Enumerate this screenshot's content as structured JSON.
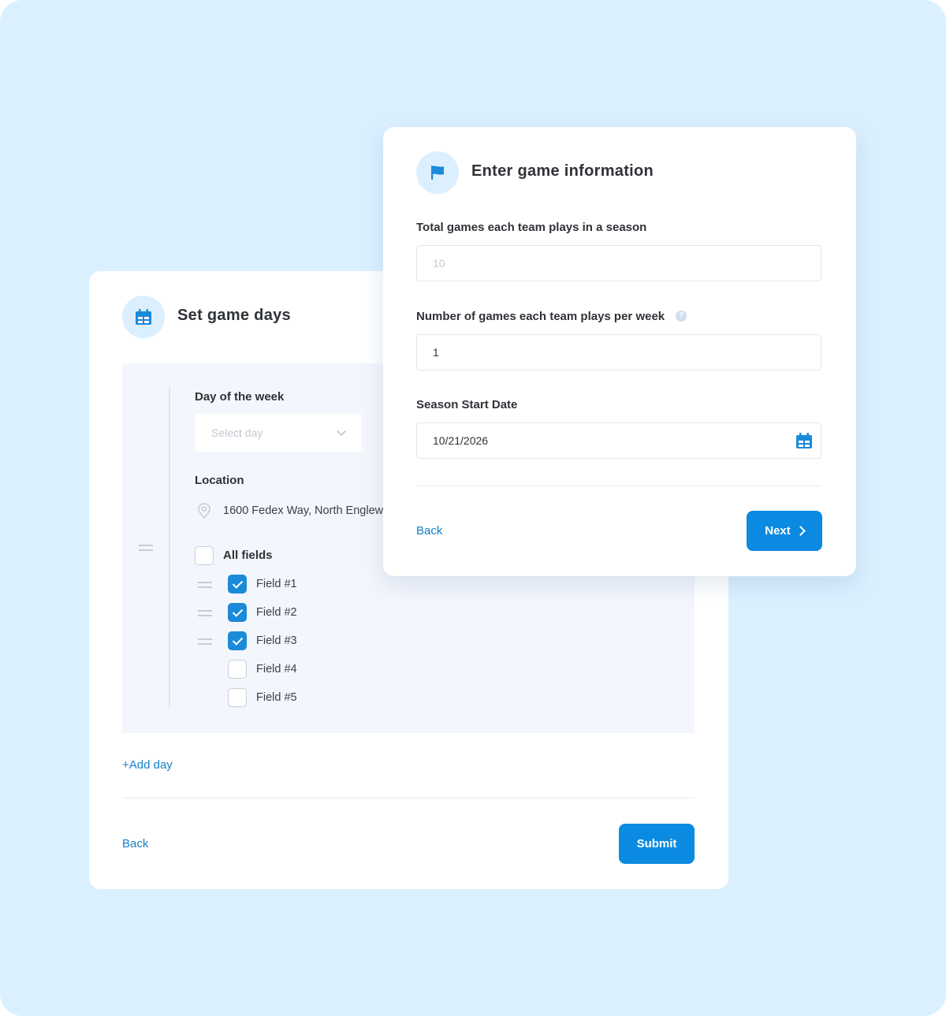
{
  "set_game_days": {
    "title": "Set game days",
    "icon": "calendar-icon",
    "day_of_week_label": "Day of the week",
    "day_select_placeholder": "Select day",
    "location_label": "Location",
    "location_address": "1600 Fedex Way, North Englew",
    "all_fields_label": "All fields",
    "fields": [
      {
        "label": "Field #1",
        "checked": true
      },
      {
        "label": "Field #2",
        "checked": true
      },
      {
        "label": "Field #3",
        "checked": true
      },
      {
        "label": "Field #4",
        "checked": false
      },
      {
        "label": "Field #5",
        "checked": false
      }
    ],
    "add_day_label": "+Add day",
    "back_label": "Back",
    "submit_label": "Submit"
  },
  "enter_game_info": {
    "title": "Enter game information",
    "icon": "flag-icon",
    "total_games_label": "Total games each team plays in a season",
    "total_games_placeholder": "10",
    "games_per_week_label": "Number of games each team plays per week",
    "games_per_week_value": "1",
    "help_icon_glyph": "?",
    "season_start_label": "Season Start Date",
    "season_start_value": "10/21/2026",
    "back_label": "Back",
    "next_label": "Next"
  },
  "colors": {
    "background": "#dbf0ff",
    "accent": "#0a8ae0",
    "link": "#1681cc",
    "panel": "#f4f6fd"
  }
}
